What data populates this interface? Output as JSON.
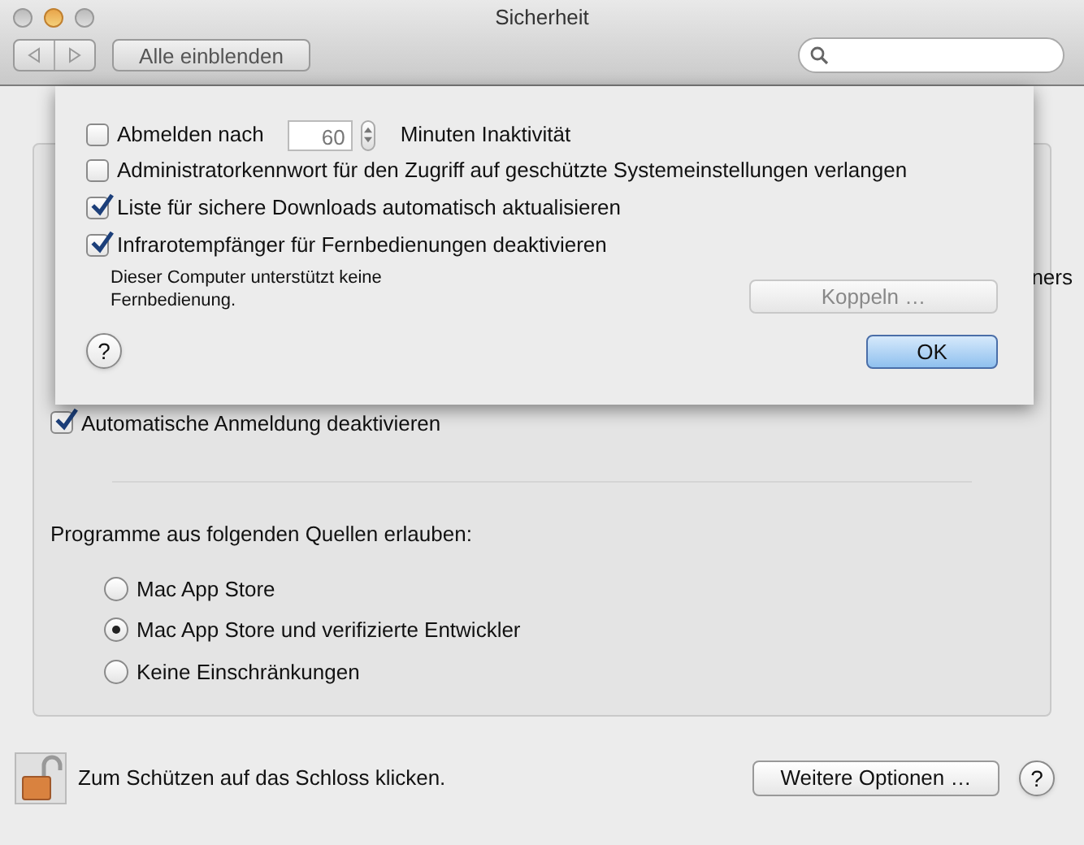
{
  "window": {
    "title": "Sicherheit"
  },
  "toolbar": {
    "show_all_button": "Alle einblenden"
  },
  "sheet": {
    "logout": {
      "checked": false,
      "label": "Abmelden nach",
      "value": "60",
      "suffix": "Minuten Inaktivität"
    },
    "options": [
      {
        "label": "Administratorkennwort für den Zugriff auf geschützte Systemeinstellungen verlangen",
        "checked": false
      },
      {
        "label": "Liste für sichere Downloads automatisch aktualisieren",
        "checked": true
      },
      {
        "label": "Infrarotempfänger für Fernbedienungen deaktivieren",
        "checked": true
      }
    ],
    "ir_note": "Dieser Computer unterstützt keine Fernbedienung.",
    "pair_button": {
      "label": "Koppeln …",
      "disabled": true
    },
    "help": "?",
    "ok_button": "OK"
  },
  "background": {
    "fragment": "ners",
    "auto_login": {
      "label": "Automatische Anmeldung deaktivieren",
      "checked": true
    }
  },
  "sources": {
    "title": "Programme aus folgenden Quellen erlauben:",
    "options": [
      {
        "label": "Mac App Store",
        "selected": false
      },
      {
        "label": "Mac App Store und verifizierte Entwickler",
        "selected": true
      },
      {
        "label": "Keine Einschränkungen",
        "selected": false
      }
    ]
  },
  "footer": {
    "lock_text": "Zum Schützen auf das Schloss klicken.",
    "more_button": "Weitere Optionen …",
    "help": "?"
  }
}
